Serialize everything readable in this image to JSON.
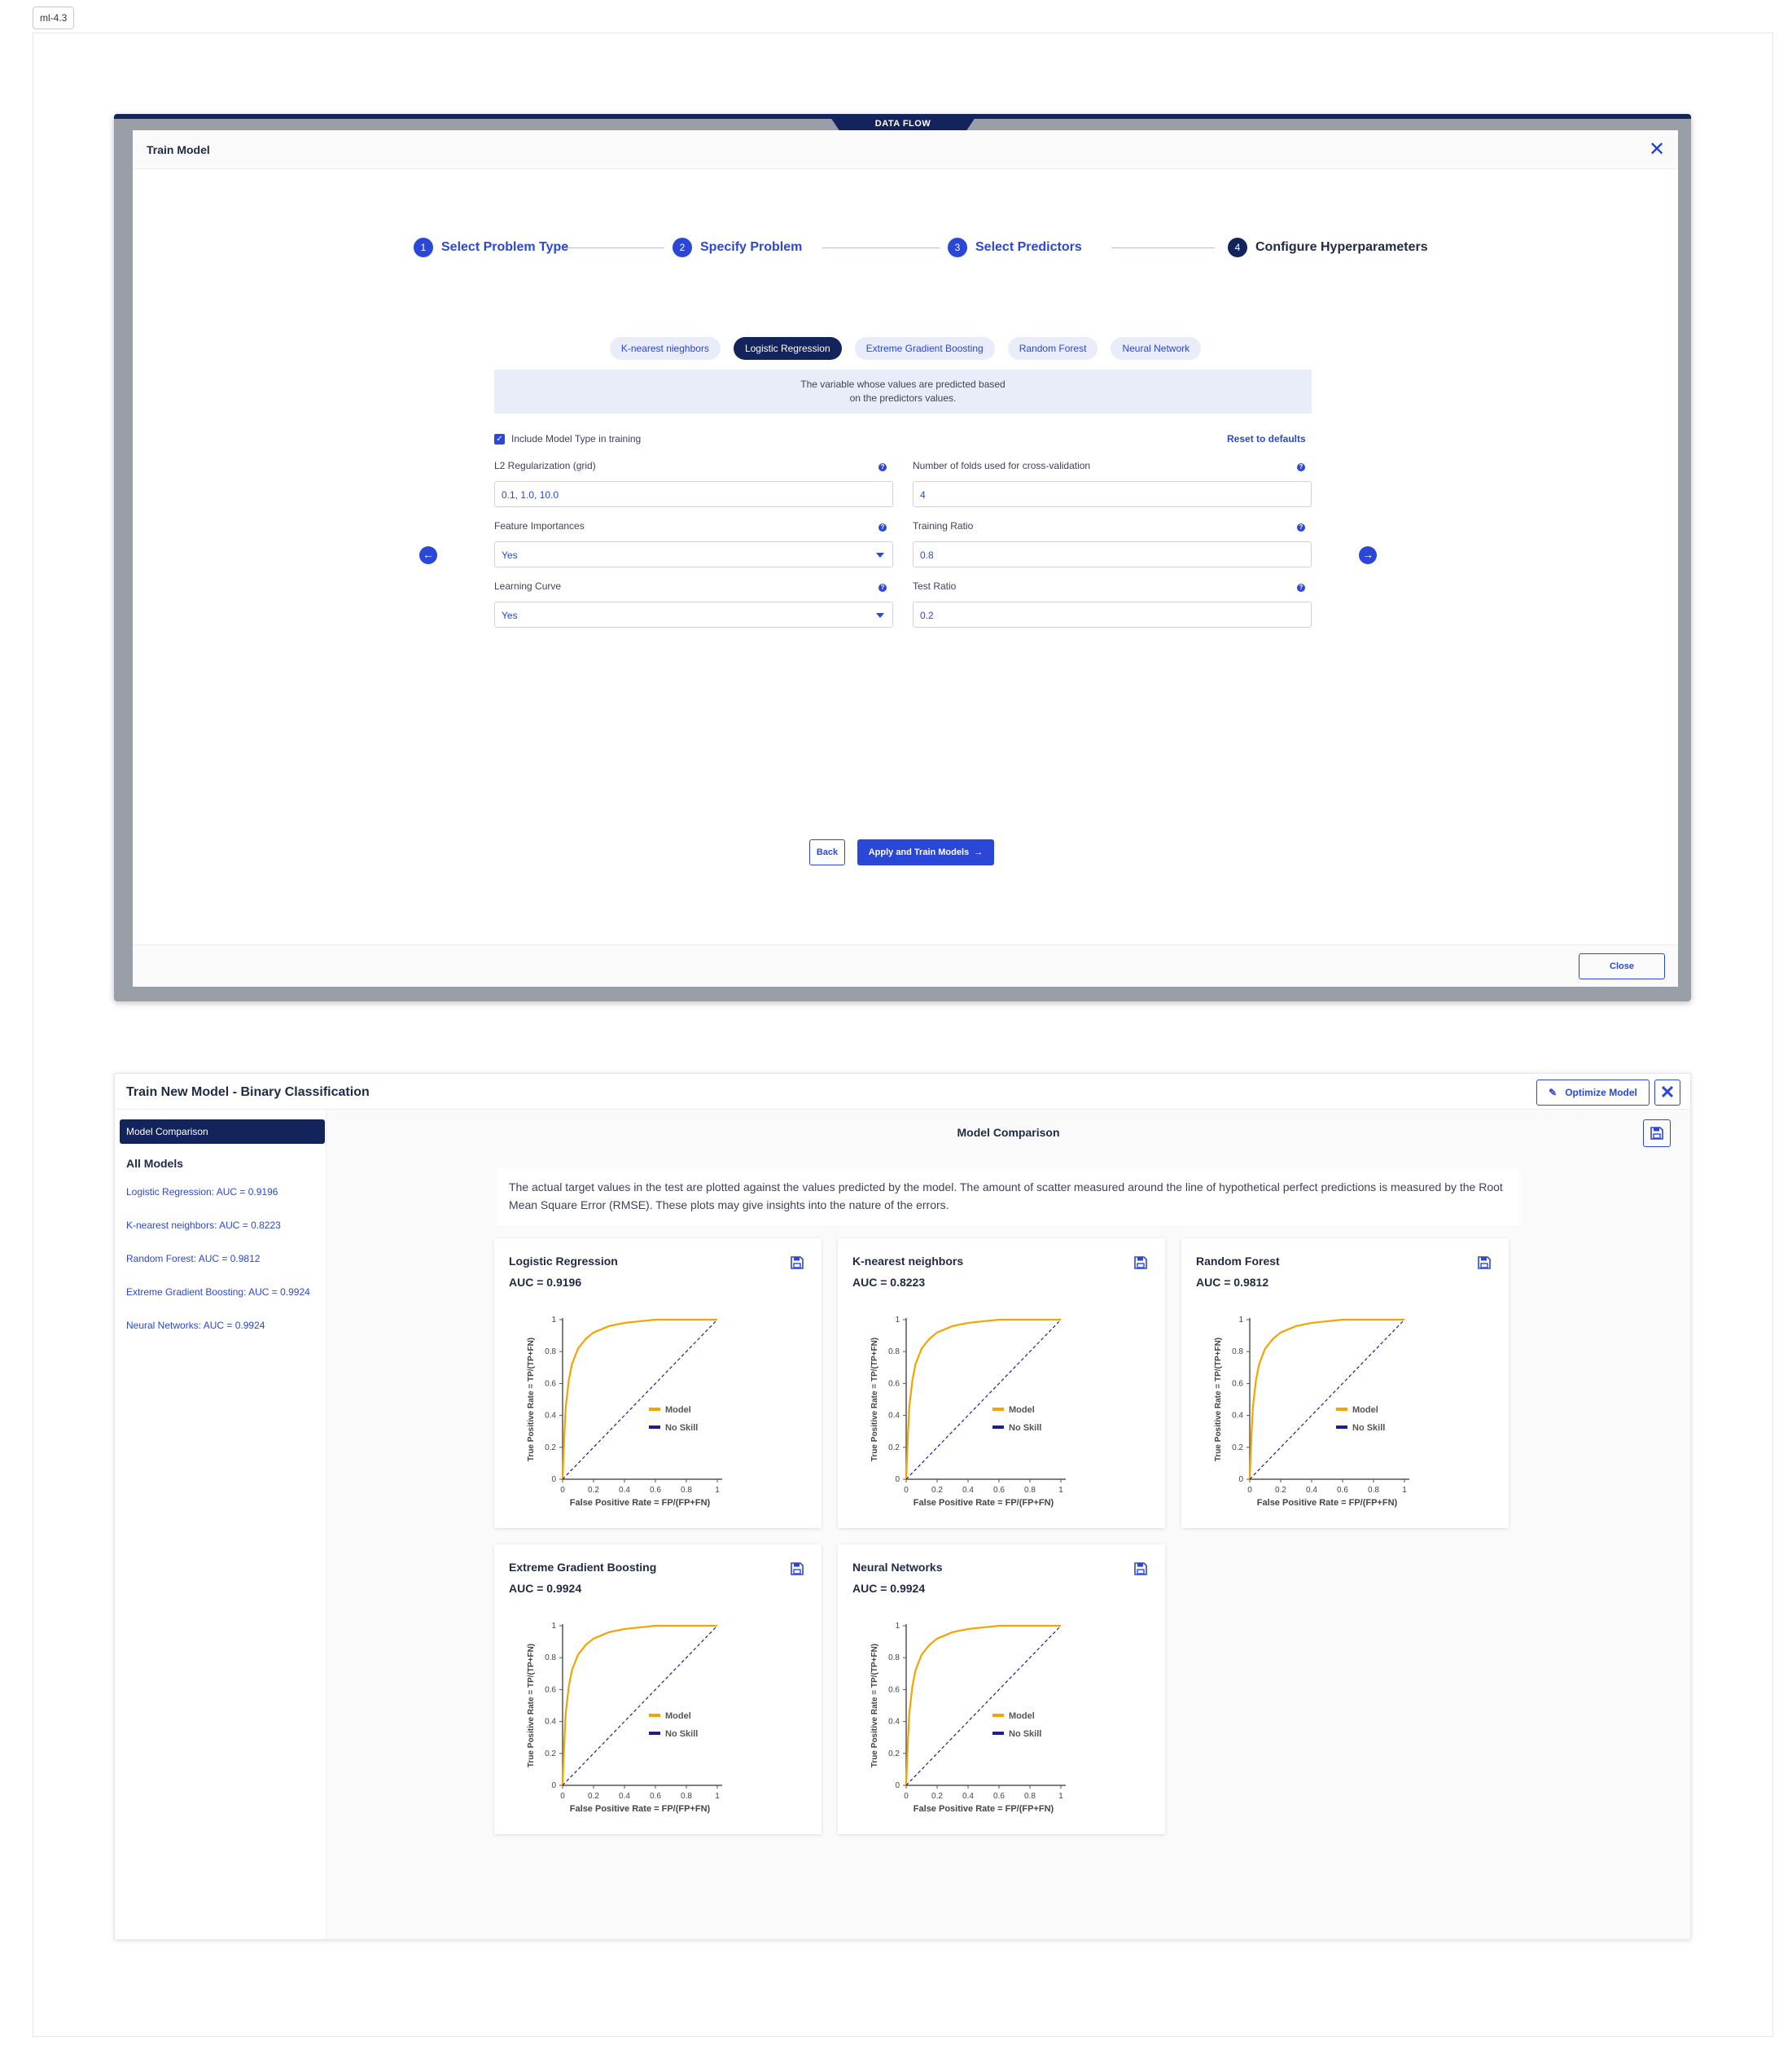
{
  "tag": "ml-4.3",
  "top_modal": {
    "dataflow_tab": "DATA FLOW",
    "title": "Train Model",
    "steps": [
      {
        "num": "1",
        "label": "Select Problem Type"
      },
      {
        "num": "2",
        "label": "Specify Problem"
      },
      {
        "num": "3",
        "label": "Select Predictors"
      },
      {
        "num": "4",
        "label": "Configure Hyperparameters"
      }
    ],
    "model_tabs": [
      "K-nearest nieghbors",
      "Logistic Regression",
      "Extreme Gradient Boosting",
      "Random Forest",
      "Neural Network"
    ],
    "active_model_tab": 1,
    "info_text": "The variable whose values are predicted based on the predictors values.",
    "include_label": "Include Model Type in training",
    "reset_label": "Reset to defaults",
    "fields": {
      "l2": {
        "label": "L2 Regularization (grid)",
        "value": "0.1, 1.0, 10.0"
      },
      "folds": {
        "label": "Number of folds used for cross-validation",
        "value": "4"
      },
      "feature_importances": {
        "label": "Feature Importances",
        "value": "Yes"
      },
      "training_ratio": {
        "label": "Training Ratio",
        "value": "0.8"
      },
      "learning_curve": {
        "label": "Learning Curve",
        "value": "Yes"
      },
      "test_ratio": {
        "label": "Test Ratio",
        "value": "0.2"
      }
    },
    "back_label": "Back",
    "train_label": "Apply and Train Models",
    "close_label": "Close",
    "accent": "#2a47d8",
    "navy": "#13235c"
  },
  "panel": {
    "title": "Train New Model - Binary Classification",
    "optimize_label": "Optimize Model",
    "sidebar_active": "Model Comparison",
    "sidebar_heading": "All Models",
    "sidebar_items": [
      "Logistic Regression: AUC = 0.9196",
      "K-nearest neighbors: AUC = 0.8223",
      "Random Forest: AUC = 0.9812",
      "Extreme Gradient Boosting: AUC = 0.9924",
      "Neural Networks: AUC = 0.9924"
    ],
    "main_title": "Model Comparison",
    "description": "The actual target values in the test are plotted against the values predicted by the model. The amount of scatter measured around the line of hypothetical perfect predictions is measured by the Root Mean Square Error (RMSE). These plots may give insights into the nature of the errors."
  },
  "chart_data": [
    {
      "type": "line",
      "title": "Logistic Regression",
      "subtitle": "AUC = 0.9196",
      "xlabel": "False Positive Rate = FP/(FP+FN)",
      "ylabel": "True Positive Rate = TP/(TP+FN)",
      "xlim": [
        0,
        1
      ],
      "ylim": [
        0,
        1
      ],
      "x_ticks": [
        "0",
        "0.2",
        "0.4",
        "0.6",
        "0.8",
        "1"
      ],
      "y_ticks": [
        "0",
        "0.2",
        "0.4",
        "0.6",
        "0.8",
        "1"
      ],
      "legend": "center-right",
      "series": [
        {
          "name": "Model",
          "color": "#f5a300",
          "x": [
            0,
            0.01,
            0.02,
            0.04,
            0.06,
            0.1,
            0.15,
            0.2,
            0.3,
            0.4,
            0.5,
            0.6,
            1
          ],
          "y": [
            0,
            0.25,
            0.45,
            0.62,
            0.72,
            0.82,
            0.88,
            0.92,
            0.96,
            0.98,
            0.99,
            1,
            1
          ]
        },
        {
          "name": "No Skill",
          "color": "#1a1f8f",
          "x": [
            0,
            1
          ],
          "y": [
            0,
            1
          ]
        }
      ]
    },
    {
      "type": "line",
      "title": "K-nearest neighbors",
      "subtitle": "AUC = 0.8223",
      "xlabel": "False Positive Rate = FP/(FP+FN)",
      "ylabel": "True Positive Rate = TP/(TP+FN)",
      "xlim": [
        0,
        1
      ],
      "ylim": [
        0,
        1
      ],
      "x_ticks": [
        "0",
        "0.2",
        "0.4",
        "0.6",
        "0.8",
        "1"
      ],
      "y_ticks": [
        "0",
        "0.2",
        "0.4",
        "0.6",
        "0.8",
        "1"
      ],
      "legend": "center-right",
      "series": [
        {
          "name": "Model",
          "color": "#f5a300",
          "x": [
            0,
            0.01,
            0.02,
            0.04,
            0.06,
            0.1,
            0.15,
            0.2,
            0.3,
            0.4,
            0.5,
            0.6,
            1
          ],
          "y": [
            0,
            0.25,
            0.45,
            0.62,
            0.72,
            0.82,
            0.88,
            0.92,
            0.96,
            0.98,
            0.99,
            1,
            1
          ]
        },
        {
          "name": "No Skill",
          "color": "#1a1f8f",
          "x": [
            0,
            1
          ],
          "y": [
            0,
            1
          ]
        }
      ]
    },
    {
      "type": "line",
      "title": "Random Forest",
      "subtitle": "AUC = 0.9812",
      "xlabel": "False Positive Rate = FP/(FP+FN)",
      "ylabel": "True Positive Rate = TP/(TP+FN)",
      "xlim": [
        0,
        1
      ],
      "ylim": [
        0,
        1
      ],
      "x_ticks": [
        "0",
        "0.2",
        "0.4",
        "0.6",
        "0.8",
        "1"
      ],
      "y_ticks": [
        "0",
        "0.2",
        "0.4",
        "0.6",
        "0.8",
        "1"
      ],
      "legend": "center-right",
      "series": [
        {
          "name": "Model",
          "color": "#f5a300",
          "x": [
            0,
            0.01,
            0.02,
            0.04,
            0.06,
            0.1,
            0.15,
            0.2,
            0.3,
            0.4,
            0.5,
            0.6,
            1
          ],
          "y": [
            0,
            0.25,
            0.45,
            0.62,
            0.72,
            0.82,
            0.88,
            0.92,
            0.96,
            0.98,
            0.99,
            1,
            1
          ]
        },
        {
          "name": "No Skill",
          "color": "#1a1f8f",
          "x": [
            0,
            1
          ],
          "y": [
            0,
            1
          ]
        }
      ]
    },
    {
      "type": "line",
      "title": "Extreme Gradient Boosting",
      "subtitle": "AUC = 0.9924",
      "xlabel": "False Positive Rate = FP/(FP+FN)",
      "ylabel": "True Positive Rate = TP/(TP+FN)",
      "xlim": [
        0,
        1
      ],
      "ylim": [
        0,
        1
      ],
      "x_ticks": [
        "0",
        "0.2",
        "0.4",
        "0.6",
        "0.8",
        "1"
      ],
      "y_ticks": [
        "0",
        "0.2",
        "0.4",
        "0.6",
        "0.8",
        "1"
      ],
      "legend": "center-right",
      "series": [
        {
          "name": "Model",
          "color": "#f5a300",
          "x": [
            0,
            0.01,
            0.02,
            0.04,
            0.06,
            0.1,
            0.15,
            0.2,
            0.3,
            0.4,
            0.5,
            0.6,
            1
          ],
          "y": [
            0,
            0.25,
            0.45,
            0.62,
            0.72,
            0.82,
            0.88,
            0.92,
            0.96,
            0.98,
            0.99,
            1,
            1
          ]
        },
        {
          "name": "No Skill",
          "color": "#1a1f8f",
          "x": [
            0,
            1
          ],
          "y": [
            0,
            1
          ]
        }
      ]
    },
    {
      "type": "line",
      "title": "Neural Networks",
      "subtitle": "AUC = 0.9924",
      "xlabel": "False Positive Rate = FP/(FP+FN)",
      "ylabel": "True Positive Rate = TP/(TP+FN)",
      "xlim": [
        0,
        1
      ],
      "ylim": [
        0,
        1
      ],
      "x_ticks": [
        "0",
        "0.2",
        "0.4",
        "0.6",
        "0.8",
        "1"
      ],
      "y_ticks": [
        "0",
        "0.2",
        "0.4",
        "0.6",
        "0.8",
        "1"
      ],
      "legend": "center-right",
      "series": [
        {
          "name": "Model",
          "color": "#f5a300",
          "x": [
            0,
            0.01,
            0.02,
            0.04,
            0.06,
            0.1,
            0.15,
            0.2,
            0.3,
            0.4,
            0.5,
            0.6,
            1
          ],
          "y": [
            0,
            0.25,
            0.45,
            0.62,
            0.72,
            0.82,
            0.88,
            0.92,
            0.96,
            0.98,
            0.99,
            1,
            1
          ]
        },
        {
          "name": "No Skill",
          "color": "#1a1f8f",
          "x": [
            0,
            1
          ],
          "y": [
            0,
            1
          ]
        }
      ]
    }
  ]
}
